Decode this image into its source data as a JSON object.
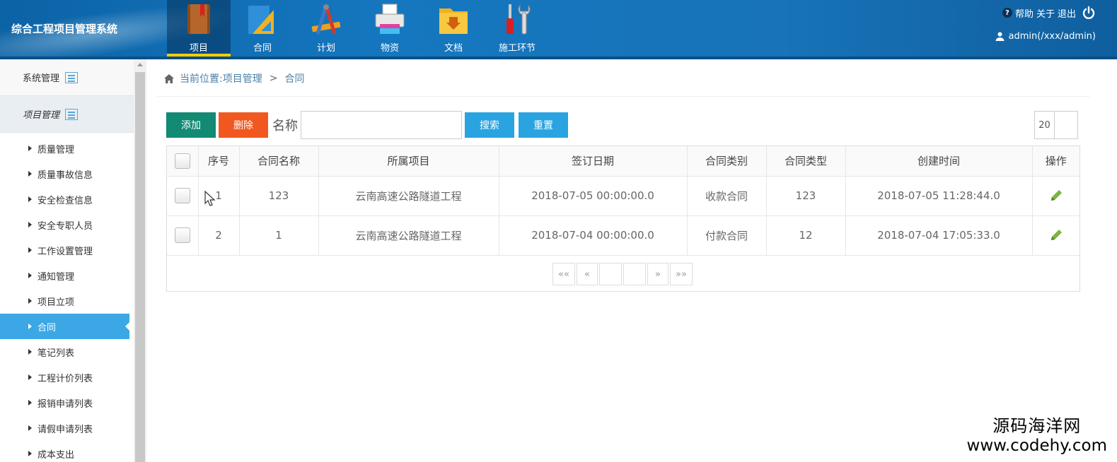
{
  "header": {
    "system_title": "综合工程项目管理系统",
    "nav": [
      {
        "label": "项目",
        "icon": "book-icon",
        "active": true
      },
      {
        "label": "合同",
        "icon": "ruler-triangle-icon",
        "active": false
      },
      {
        "label": "计划",
        "icon": "drafting-tools-icon",
        "active": false
      },
      {
        "label": "物资",
        "icon": "printer-icon",
        "active": false
      },
      {
        "label": "文档",
        "icon": "folder-download-icon",
        "active": false
      },
      {
        "label": "施工环节",
        "icon": "tools-icon",
        "active": false
      }
    ],
    "links": {
      "help": "帮助",
      "about": "关于",
      "logout": "退出"
    },
    "user": "admin(/xxx/admin)"
  },
  "sidebar": {
    "sections": [
      {
        "label": "系统管理"
      },
      {
        "label": "项目管理"
      }
    ],
    "items": [
      {
        "label": "质量管理"
      },
      {
        "label": "质量事故信息"
      },
      {
        "label": "安全检查信息"
      },
      {
        "label": "安全专职人员"
      },
      {
        "label": "工作设置管理"
      },
      {
        "label": "通知管理"
      },
      {
        "label": "项目立项"
      },
      {
        "label": "合同"
      },
      {
        "label": "笔记列表"
      },
      {
        "label": "工程计价列表"
      },
      {
        "label": "报销申请列表"
      },
      {
        "label": "请假申请列表"
      },
      {
        "label": "成本支出"
      }
    ],
    "active_index": 7
  },
  "breadcrumb": {
    "prefix": "当前位置:项目管理",
    "sep": ">",
    "current": "合同"
  },
  "toolbar": {
    "add": "添加",
    "delete": "删除",
    "name_label": "名称",
    "name_value": "",
    "search": "搜索",
    "reset": "重置",
    "page_size": "20"
  },
  "table": {
    "headers": [
      "序号",
      "合同名称",
      "所属项目",
      "签订日期",
      "合同类别",
      "合同类型",
      "创建时间",
      "操作"
    ],
    "rows": [
      [
        "1",
        "123",
        "云南高速公路隧道工程",
        "2018-07-05 00:00:00.0",
        "收款合同",
        "123",
        "2018-07-05 11:28:44.0"
      ],
      [
        "2",
        "1",
        "云南高速公路隧道工程",
        "2018-07-04 00:00:00.0",
        "付款合同",
        "12",
        "2018-07-04 17:05:33.0"
      ]
    ]
  },
  "pager": {
    "first": "««",
    "prev": "«",
    "page": "",
    "total": "",
    "next": "»",
    "last": "»»"
  },
  "watermark": {
    "line1": "源码海洋网",
    "line2": "www.codehy.com"
  },
  "colors": {
    "header": "#1577bf",
    "active_nav": "#0a4f86",
    "sidebar_active": "#3ba7e4",
    "add": "#138a73",
    "delete": "#f1581f",
    "search": "#29a4e0"
  }
}
